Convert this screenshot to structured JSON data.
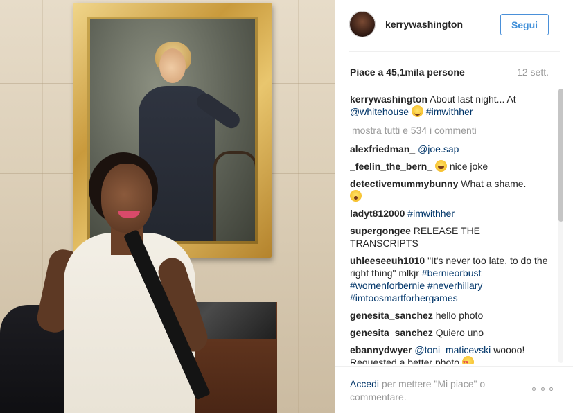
{
  "photo": {
    "alt": ""
  },
  "post": {
    "username": "kerrywashington",
    "follow_label": "Segui",
    "likes": "Piace a 45,1mila persone",
    "date": "12 sett."
  },
  "caption": {
    "user": "kerrywashington",
    "text_1": "About last night... At",
    "mention": "@whitehouse",
    "hashtag": "#imwithher"
  },
  "show_all": "mostra tutti e 534 i commenti",
  "comments": [
    {
      "user": "alexfriedman_",
      "link": "@joe.sap"
    },
    {
      "user": "_feelin_the_bern_",
      "text": "nice joke"
    },
    {
      "user": "detectivemummybunny",
      "text": "What a shame."
    },
    {
      "user": "ladyt812000",
      "link": "#imwithher"
    },
    {
      "user": "supergongee",
      "text": "RELEASE THE TRANSCRIPTS"
    },
    {
      "user": "uhleeseeuh1010",
      "text": "\"It's never too late, to do the right thing\" mlkjr",
      "tags": "#bernieorbust #womenforbernie #neverhillary #imtoosmartforhergames"
    },
    {
      "user": "genesita_sanchez",
      "text": "hello photo"
    },
    {
      "user": "genesita_sanchez",
      "text": "Quiero uno"
    },
    {
      "user": "ebannydwyer",
      "link": "@toni_maticevski",
      "text": "woooo! Requested a better photo"
    }
  ],
  "footer": {
    "login_link": "Accedi",
    "login_text": "per mettere \"Mi piace\" o commentare."
  },
  "icons": {
    "more": "more-options-icon",
    "avatar": "profile-avatar"
  }
}
